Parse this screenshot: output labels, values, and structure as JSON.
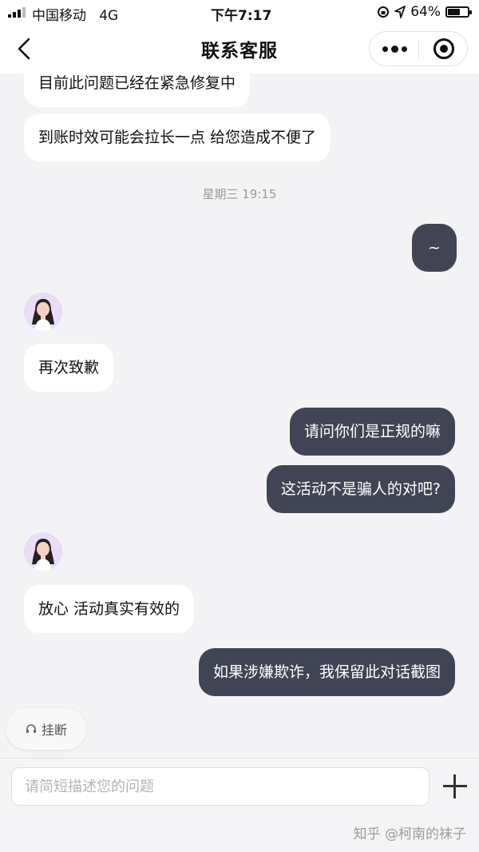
{
  "status_bar": {
    "carrier": "中国移动",
    "network": "4G",
    "time": "下午7:17",
    "battery": "64%",
    "battery_level": 0.64,
    "icons": [
      "signal-icon",
      "location-icon",
      "orientation-lock-icon",
      "battery-icon"
    ]
  },
  "nav": {
    "title": "联系客服",
    "back_icon": "chevron-left-icon",
    "more_icon": "more-dots-icon",
    "close_icon": "target-close-icon"
  },
  "chat": {
    "messages": [
      {
        "sender": "agent",
        "text": "目前此问题已经在紧急修复中"
      },
      {
        "sender": "agent",
        "text": "到账时效可能会拉长一点 给您造成不便了"
      },
      {
        "sender": "user",
        "text": "~"
      },
      {
        "sender": "agent",
        "text": "再次致歉"
      },
      {
        "sender": "user",
        "text": "请问你们是正规的嘛"
      },
      {
        "sender": "user",
        "text": "这活动不是骗人的对吧?"
      },
      {
        "sender": "agent",
        "text": "放心 活动真实有效的"
      },
      {
        "sender": "user",
        "text": "如果涉嫌欺诈，我保留此对话截图"
      }
    ],
    "timestamp": "星期三 19:15",
    "hangup_label": "挂断",
    "hangup_icon": "headset-icon"
  },
  "input": {
    "placeholder": "请简短描述您的问题",
    "value": "",
    "plus_icon": "plus-icon"
  },
  "watermark": "知乎 @柯南的袜子",
  "colors": {
    "background": "#f3f3f5",
    "agent_bubble": "#ffffff",
    "user_bubble": "#414454",
    "avatar_bg": "#e9dcf4"
  }
}
